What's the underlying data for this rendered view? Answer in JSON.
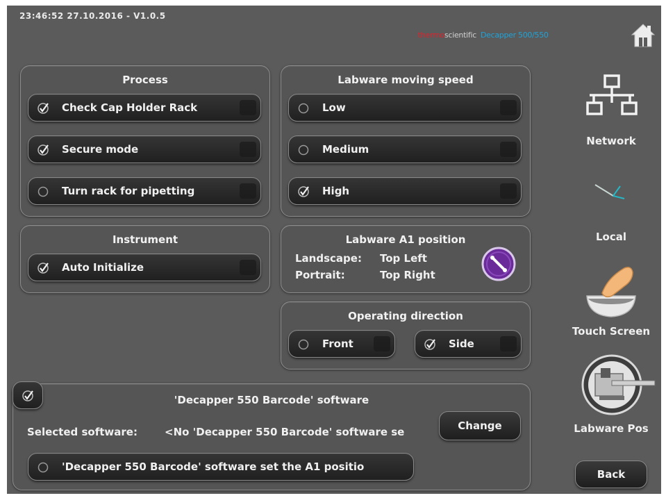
{
  "header": {
    "datetime_version": "23:46:52 27.10.2016 - V1.0.5",
    "brand_thermo": "thermo",
    "brand_scientific": "scientific",
    "brand_product": "Decapper 500/550"
  },
  "process": {
    "title": "Process",
    "options": [
      {
        "label": "Check Cap Holder Rack",
        "checked": true
      },
      {
        "label": "Secure mode",
        "checked": true
      },
      {
        "label": "Turn rack for pipetting",
        "checked": false
      }
    ]
  },
  "speed": {
    "title": "Labware moving speed",
    "options": [
      {
        "label": "Low",
        "selected": false
      },
      {
        "label": "Medium",
        "selected": false
      },
      {
        "label": "High",
        "selected": true
      }
    ]
  },
  "instrument": {
    "title": "Instrument",
    "options": [
      {
        "label": "Auto Initialize",
        "checked": true
      }
    ]
  },
  "a1_position": {
    "title": "Labware A1 position",
    "landscape_label": "Landscape:",
    "landscape_value": "Top Left",
    "portrait_label": "Portrait:",
    "portrait_value": "Top Right"
  },
  "operating_direction": {
    "title": "Operating direction",
    "options": [
      {
        "label": "Front",
        "selected": false
      },
      {
        "label": "Side",
        "selected": true
      }
    ]
  },
  "barcode": {
    "title": "'Decapper 550 Barcode' software",
    "enabled": true,
    "selected_label": "Selected software:",
    "selected_value": "<No 'Decapper 550 Barcode' software se",
    "change_label": "Change",
    "a1_option_label": "'Decapper 550 Barcode' software set the A1 positio",
    "a1_option_checked": false
  },
  "sidebar": {
    "network": "Network",
    "local": "Local",
    "touch_screen": "Touch Screen",
    "labware_pos": "Labware Pos",
    "back": "Back"
  },
  "colors": {
    "screen_bg": "#5b5b5b",
    "brand_red": "#e0202a",
    "brand_blue": "#1fa3d8",
    "rotate_purple": "#6a2a9a"
  }
}
